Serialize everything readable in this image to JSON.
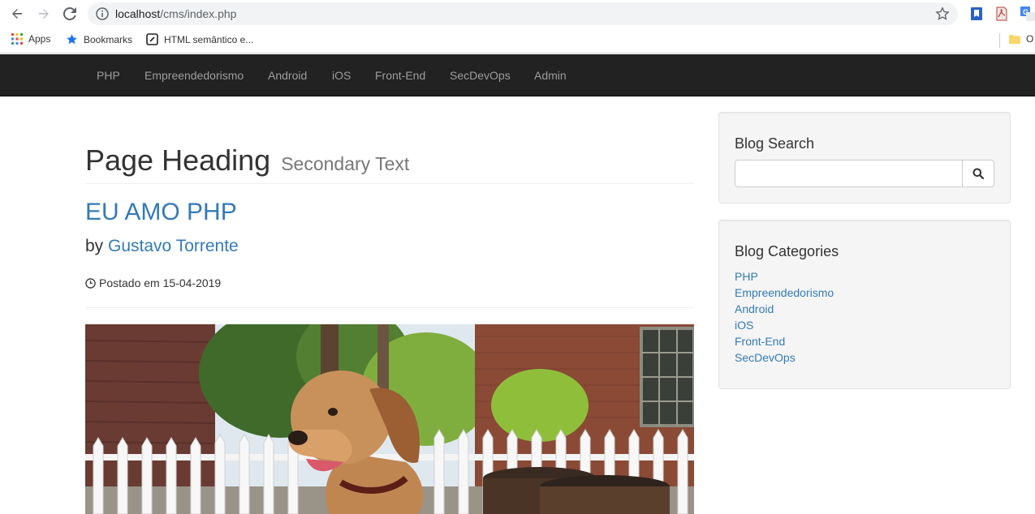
{
  "browser": {
    "url_host": "localhost",
    "url_path": "/cms/index.php",
    "bookmarks": {
      "apps": "Apps",
      "bookmarks": "Bookmarks",
      "html_semantico": "HTML semântico e...",
      "other_initial": "O"
    }
  },
  "navbar": {
    "items": [
      "PHP",
      "Empreendedorismo",
      "Android",
      "iOS",
      "Front-End",
      "SecDevOps",
      "Admin"
    ]
  },
  "main": {
    "heading": "Page Heading",
    "heading_small": "Secondary Text",
    "post_title": "EU AMO PHP",
    "by_label": "by",
    "author": "Gustavo Torrente",
    "posted": "Postado em 15-04-2019"
  },
  "sidebar": {
    "search_title": "Blog Search",
    "search_value": "",
    "categories_title": "Blog Categories",
    "categories": [
      "PHP",
      "Empreendedorismo",
      "Android",
      "iOS",
      "Front-End",
      "SecDevOps"
    ]
  },
  "colors": {
    "navbar_bg": "#222222",
    "nav_link": "#9d9d9d",
    "link": "#337ab7",
    "well_bg": "#f5f5f5"
  }
}
